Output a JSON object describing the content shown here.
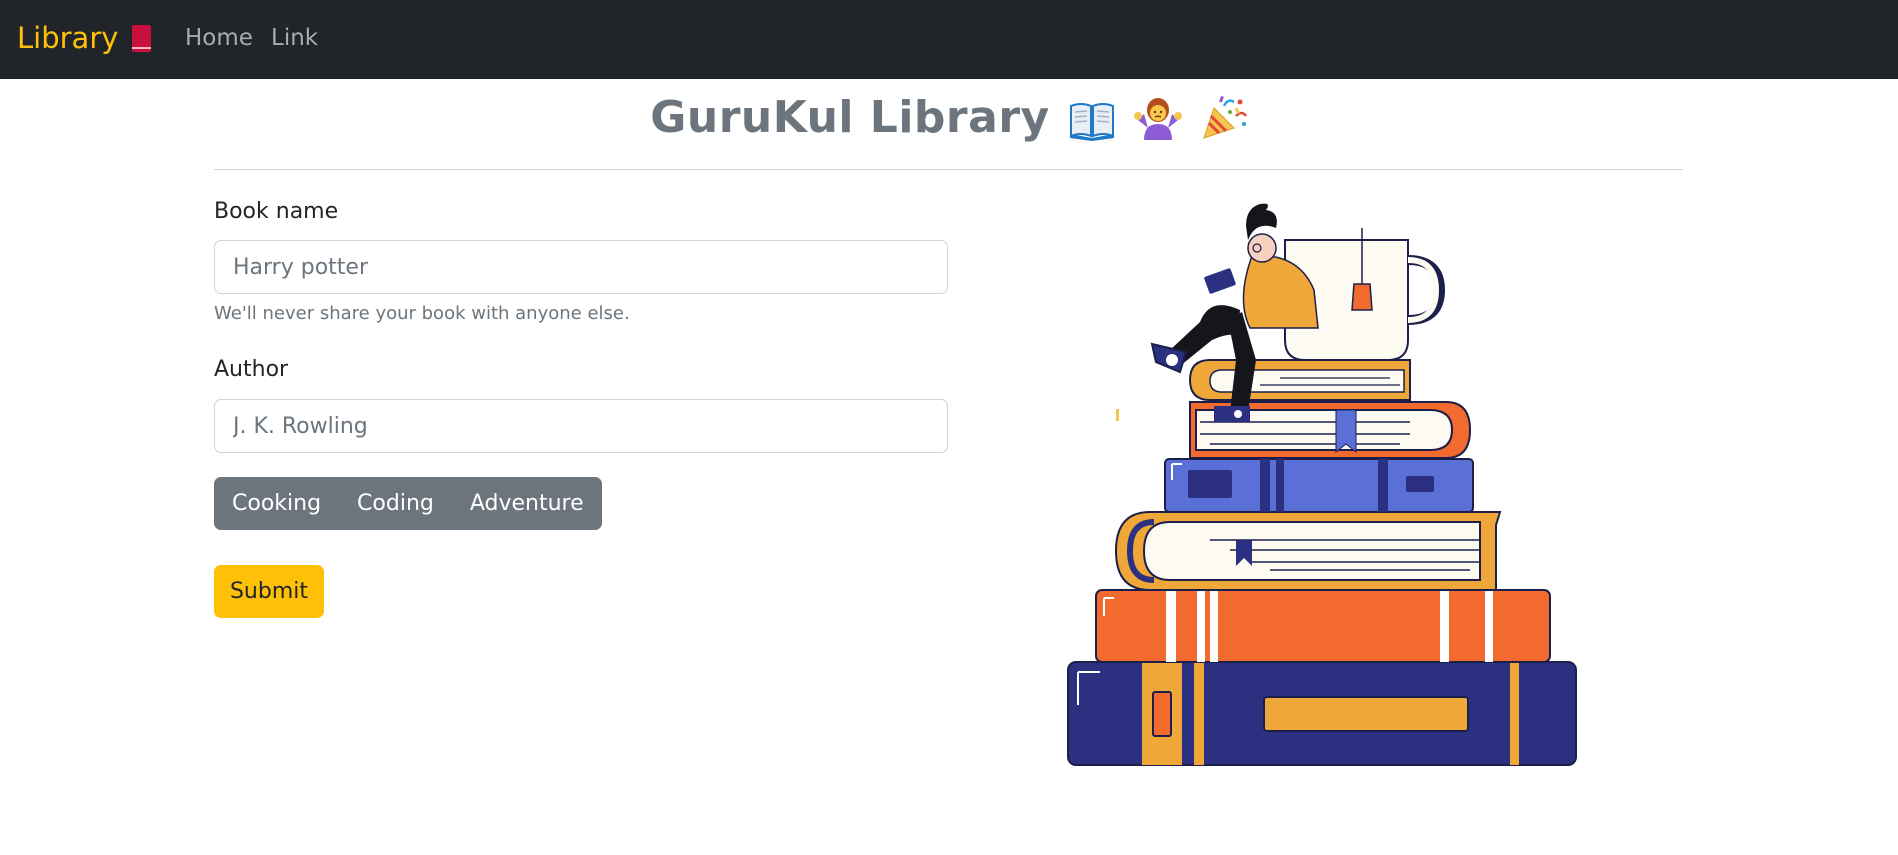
{
  "navbar": {
    "brand": "Library",
    "brand_icon": "red-book-icon",
    "links": [
      "Home",
      "Link"
    ]
  },
  "heading": {
    "title": "GuruKul Library",
    "emojis": [
      "open-book-emoji",
      "woman-shrugging-emoji",
      "party-popper-emoji"
    ]
  },
  "form": {
    "book_name_label": "Book name",
    "book_name_placeholder": "Harry potter",
    "book_name_help": "We'll never share your book with anyone else.",
    "author_label": "Author",
    "author_placeholder": "J. K. Rowling",
    "genres": [
      "Cooking",
      "Coding",
      "Adventure"
    ],
    "submit_label": "Submit"
  },
  "colors": {
    "navbar_bg": "#212529",
    "brand": "#ffc107",
    "submit": "#ffc107",
    "genre_group": "#6c757d",
    "heading": "#6c757d"
  }
}
